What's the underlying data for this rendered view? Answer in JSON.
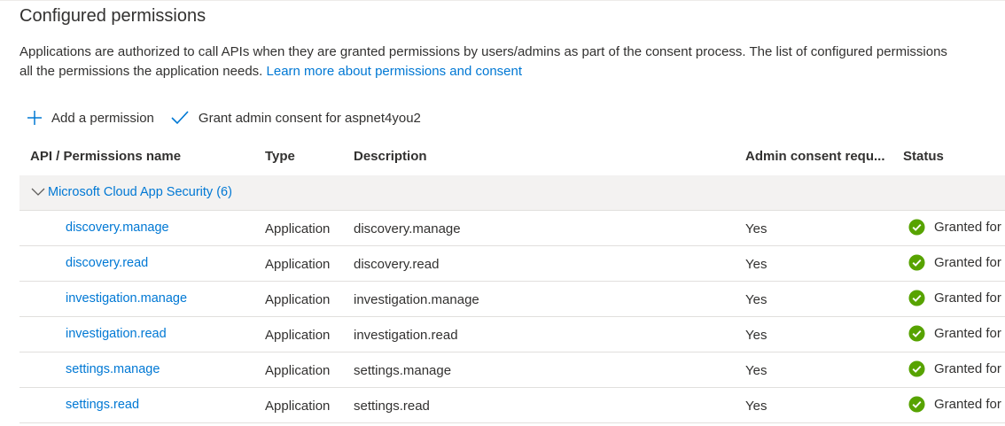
{
  "header": {
    "title": "Configured permissions",
    "description_line1": "Applications are authorized to call APIs when they are granted permissions by users/admins as part of the consent process. The list of configured permissions",
    "description_line2": "all the permissions the application needs.",
    "learn_more_link": "Learn more about permissions and consent"
  },
  "toolbar": {
    "add_label": "Add a permission",
    "grant_label": "Grant admin consent for aspnet4you2"
  },
  "table": {
    "columns": [
      "API / Permissions name",
      "Type",
      "Description",
      "Admin consent requ...",
      "Status"
    ],
    "group": {
      "label": "Microsoft Cloud App Security (6)"
    },
    "rows": [
      {
        "name": "discovery.manage",
        "type": "Application",
        "description": "discovery.manage",
        "admin_consent": "Yes",
        "status": "Granted for"
      },
      {
        "name": "discovery.read",
        "type": "Application",
        "description": "discovery.read",
        "admin_consent": "Yes",
        "status": "Granted for"
      },
      {
        "name": "investigation.manage",
        "type": "Application",
        "description": "investigation.manage",
        "admin_consent": "Yes",
        "status": "Granted for"
      },
      {
        "name": "investigation.read",
        "type": "Application",
        "description": "investigation.read",
        "admin_consent": "Yes",
        "status": "Granted for"
      },
      {
        "name": "settings.manage",
        "type": "Application",
        "description": "settings.manage",
        "admin_consent": "Yes",
        "status": "Granted for"
      },
      {
        "name": "settings.read",
        "type": "Application",
        "description": "settings.read",
        "admin_consent": "Yes",
        "status": "Granted for"
      }
    ]
  },
  "icons": {
    "add": "plus-icon",
    "grant": "checkmark-icon",
    "group_toggle": "chevron-down-icon",
    "status": "success-check-circle-icon"
  },
  "colors": {
    "link": "#0078d4",
    "success": "#57a300",
    "group_bg": "#f3f2f1"
  }
}
